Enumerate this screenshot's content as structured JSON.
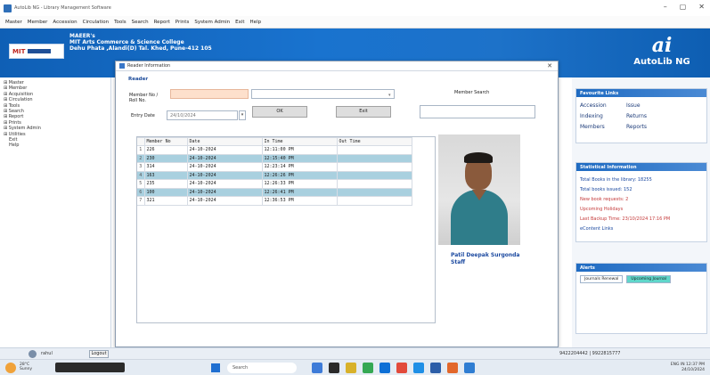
{
  "window": {
    "title": "AutoLib NG - Library Management Software",
    "controls": [
      "–",
      "▢",
      "✕"
    ]
  },
  "menu": [
    "Master",
    "Member",
    "Accession",
    "Circulation",
    "Tools",
    "Search",
    "Report",
    "Prints",
    "System Admin",
    "Exit",
    "Help"
  ],
  "banner": {
    "logo_text": "MIT",
    "line1": "MAEER's",
    "line2": "MIT Arts Commerce & Science College",
    "line3": "Dehu Phata ,Alandi(D) Tal. Khed, Pune-412 105",
    "brand_mark": "ai",
    "brand_name": "AutoLib NG"
  },
  "sidebar": {
    "items": [
      {
        "label": "⊞ Master",
        "sub": false
      },
      {
        "label": "⊞ Member",
        "sub": false
      },
      {
        "label": "⊞ Acquisition",
        "sub": false
      },
      {
        "label": "⊞ Circulation",
        "sub": false
      },
      {
        "label": "⊞ Tools",
        "sub": false
      },
      {
        "label": "⊞ Search",
        "sub": false
      },
      {
        "label": "⊞ Report",
        "sub": false
      },
      {
        "label": "⊞ Prints",
        "sub": false
      },
      {
        "label": "⊞ System Admin",
        "sub": false
      },
      {
        "label": "⊞ Utilities",
        "sub": false
      },
      {
        "label": "Exit",
        "sub": true
      },
      {
        "label": "Help",
        "sub": true
      }
    ]
  },
  "user_bar": {
    "username": "rahul",
    "logout_label": "Logout",
    "phone": "9422204442 | 9922815777"
  },
  "dialog": {
    "title": "Reader Information",
    "close": "✕",
    "section_label": "Reader",
    "member_no_label": "Member No / Roll No.",
    "member_no_value": "",
    "member_name_value": "",
    "entry_date_label": "Entry Date",
    "entry_date_value": "24/10/2024",
    "ok_label": "OK",
    "exit_label": "Exit",
    "member_search_label": "Member Search",
    "member_search_value": ""
  },
  "grid": {
    "columns": [
      "Member No",
      "Date",
      "In Time",
      "Out Time"
    ],
    "rows": [
      {
        "idx": "1",
        "member": "226",
        "date": "24-10-2024",
        "in": "12:11:00 PM",
        "out": "",
        "highlight": false
      },
      {
        "idx": "2",
        "member": "230",
        "date": "24-10-2024",
        "in": "12:15:40 PM",
        "out": "",
        "highlight": true
      },
      {
        "idx": "3",
        "member": "314",
        "date": "24-10-2024",
        "in": "12:23:14 PM",
        "out": "",
        "highlight": false
      },
      {
        "idx": "4",
        "member": "163",
        "date": "24-10-2024",
        "in": "12:26:26 PM",
        "out": "",
        "highlight": true
      },
      {
        "idx": "5",
        "member": "235",
        "date": "24-10-2024",
        "in": "12:26:33 PM",
        "out": "",
        "highlight": false
      },
      {
        "idx": "6",
        "member": "100",
        "date": "24-10-2024",
        "in": "12:26:41 PM",
        "out": "",
        "highlight": true
      },
      {
        "idx": "7",
        "member": "321",
        "date": "24-10-2024",
        "in": "12:36:53 PM",
        "out": "",
        "highlight": false
      }
    ]
  },
  "staff": {
    "name_line1": "Patil Deepak Surgonda",
    "name_line2": "Staff"
  },
  "right_panel": {
    "favourites_title": "Favourite Links",
    "favourites": [
      "Accession",
      "Issue",
      "Indexing",
      "Returns",
      "Members",
      "Reports"
    ],
    "stats_title": "Statistical Information",
    "stats": [
      {
        "label": "Total Books in the library:",
        "value": "18255",
        "style": "blue"
      },
      {
        "label": "Total books issued:",
        "value": "152",
        "style": "blue"
      },
      {
        "label": "New book requests:",
        "value": "2",
        "style": "red"
      },
      {
        "label": "Upcoming Holidays",
        "value": "",
        "style": "red"
      },
      {
        "label": "Last Backup Time: 23/10/2024 17:16 PM",
        "value": "",
        "style": "red"
      },
      {
        "label": "eContent Links",
        "value": "",
        "style": "blue"
      }
    ],
    "alerts_title": "Alerts",
    "alert_tabs": [
      "Journals Renewal",
      "Upcoming Journal"
    ]
  },
  "taskbar": {
    "weather_temp": "28°C",
    "weather_desc": "Sunny",
    "search_placeholder": "Search",
    "time": "12:37 PM",
    "date": "24/10/2024",
    "tray_lang": "ENG IN"
  },
  "colors": {
    "banner": "#1973cf",
    "highlight_row": "#a9d0df",
    "member_field": "#fde0cc",
    "link": "#1c4aa0",
    "alert_tab_active": "#5fd6c9"
  }
}
